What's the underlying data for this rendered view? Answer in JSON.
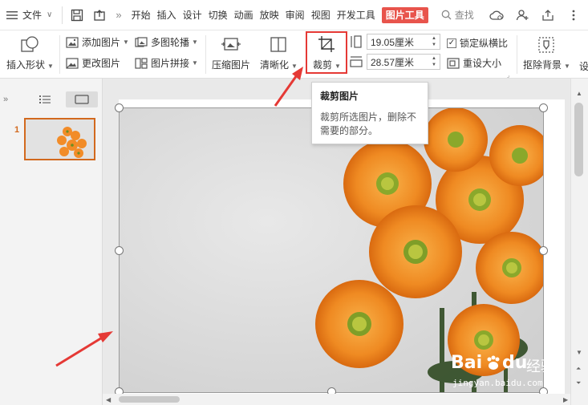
{
  "menubar": {
    "file_label": "文件",
    "more_glyph": "»",
    "tabs": [
      "开始",
      "插入",
      "设计",
      "切换",
      "动画",
      "放映",
      "审阅",
      "视图",
      "开发工具"
    ],
    "active_tab": "图片工具",
    "search_label": "查找"
  },
  "ribbon": {
    "insert_shape": "插入形状",
    "add_picture": "添加图片",
    "change_picture": "更改图片",
    "multi_carousel": "多图轮播",
    "picture_collage": "图片拼接",
    "compress_picture": "压缩图片",
    "sharpen": "清晰化",
    "crop": "裁剪",
    "height_value": "19.05厘米",
    "width_value": "28.57厘米",
    "lock_ratio": "锁定纵横比",
    "reset_size": "重设大小",
    "remove_background": "抠除背景",
    "cut_off_label": "设"
  },
  "tooltip": {
    "title": "裁剪图片",
    "description": "裁剪所选图片，删除不需要的部分。"
  },
  "slides_panel": {
    "slide_number": "1"
  },
  "watermark": {
    "brand": "Bai",
    "brand2": "du",
    "cn": "经验",
    "url": "jingyan.baidu.com"
  },
  "colors": {
    "accent": "#e8544c",
    "highlight_box": "#e53935",
    "annotation_arrow": "#e53935",
    "slide_selected": "#d2691e",
    "flower_orange": "#f28c28"
  }
}
